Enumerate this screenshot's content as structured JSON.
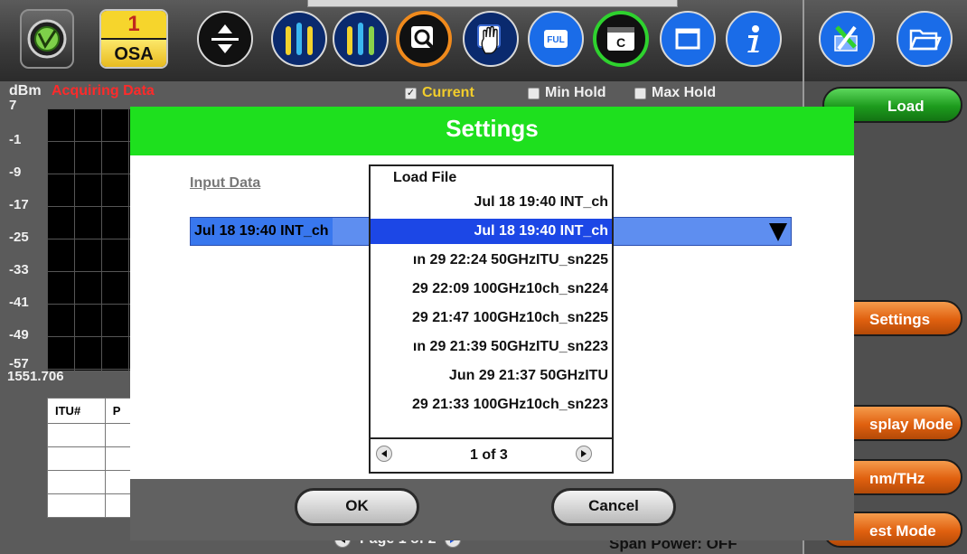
{
  "toolbar": {
    "module_number": "1",
    "module_label": "OSA",
    "icons": [
      "home-icon",
      "osa-module",
      "vertical-scale-icon",
      "marker-one-icon",
      "marker-two-icon",
      "zoom-icon",
      "pan-hand-icon",
      "full-view-icon",
      "channel-icon",
      "window-icon",
      "info-icon",
      "tools-icon",
      "folder-icon"
    ],
    "full_label": "FUL",
    "channel_label": "C"
  },
  "chart": {
    "unit": "dBm",
    "status": "Acquiring Data",
    "current_label": "Current",
    "min_hold_label": "Min Hold",
    "max_hold_label": "Max Hold",
    "current_checked": true,
    "y_ticks": [
      "7",
      "-1",
      "-9",
      "-17",
      "-25",
      "-33",
      "-41",
      "-49",
      "-57"
    ],
    "x_start": "1551.706"
  },
  "table": {
    "headers": [
      "ITU#",
      "P"
    ],
    "rows": 4
  },
  "footer": {
    "page_label": "Page 1 of 2",
    "span_power": "Span Power: OFF"
  },
  "right_panel": {
    "load": "Load",
    "settings": "Settings",
    "display_mode": "splay Mode",
    "nm_thz": "nm/THz",
    "test_mode": "est Mode"
  },
  "dialog": {
    "title": "Settings",
    "input_label": "Input Data",
    "input_value": "Jul 18 19:40 INT_ch",
    "dropdown": {
      "title": "Load File",
      "items": [
        "Jul 18 19:40 INT_ch",
        "Jul 18 19:40 INT_ch",
        "ın 29 22:24 50GHzITU_sn225",
        "29 22:09 100GHz10ch_sn224",
        "29 21:47 100GHz10ch_sn225",
        "ın 29 21:39 50GHzITU_sn223",
        "Jun 29 21:37 50GHzITU",
        "29 21:33 100GHz10ch_sn223"
      ],
      "selected_index": 1,
      "page": "1 of 3"
    },
    "ok": "OK",
    "cancel": "Cancel"
  },
  "colors": {
    "dialog_header": "#1ee01e",
    "selection": "#1c47e6",
    "status_red": "#ff2a2a",
    "current_yellow": "#f2cd2b",
    "load_green": "#1d9b1d",
    "side_orange": "#e0600f"
  }
}
